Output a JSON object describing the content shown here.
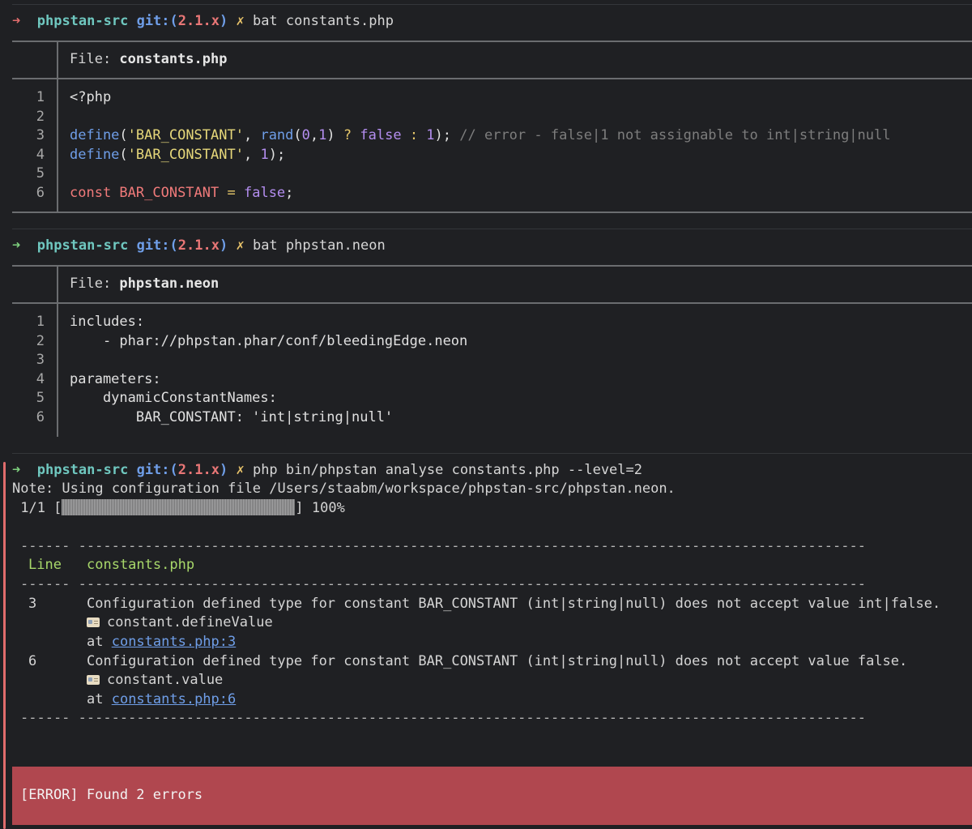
{
  "prompt": {
    "arrow": "➜",
    "dir": "phpstan-src",
    "git_prefix": "git:(",
    "branch": "2.1.x",
    "git_suffix": ")",
    "dirty_mark": "✗"
  },
  "command1": "bat constants.php",
  "file1": {
    "label": "File: ",
    "name": "constants.php",
    "line_numbers": [
      "1",
      "2",
      "3",
      "4",
      "5",
      "6"
    ],
    "lines": {
      "l1": "<?php",
      "l3_define": "define",
      "l3_open": "(",
      "l3_str": "'BAR_CONSTANT'",
      "l3_comma": ", ",
      "l3_rand": "rand",
      "l3_args_open": "(",
      "l3_zero": "0",
      "l3_argcomma": ",",
      "l3_one": "1",
      "l3_args_close": ") ",
      "l3_q": "?",
      "l3_sp": " ",
      "l3_false": "false",
      "l3_colon": " : ",
      "l3_one2": "1",
      "l3_close": ");",
      "l3_comment": " // error - false|1 not assignable to int|string|null",
      "l4_define": "define",
      "l4_open": "(",
      "l4_str": "'BAR_CONSTANT'",
      "l4_comma": ", ",
      "l4_one": "1",
      "l4_close": ");",
      "l6_const": "const",
      "l6_name": " BAR_CONSTANT ",
      "l6_eq": "=",
      "l6_sp": " ",
      "l6_false": "false",
      "l6_semi": ";"
    }
  },
  "command2": "bat phpstan.neon",
  "file2": {
    "label": "File: ",
    "name": "phpstan.neon",
    "line_numbers": [
      "1",
      "2",
      "3",
      "4",
      "5",
      "6"
    ],
    "lines": [
      "includes:",
      "    - phar://phpstan.phar/conf/bleedingEdge.neon",
      "",
      "parameters:",
      "    dynamicConstantNames:",
      "        BAR_CONSTANT: 'int|string|null'"
    ]
  },
  "command3": "php bin/phpstan analyse constants.php --level=2",
  "analysis": {
    "note": "Note: Using configuration file /Users/staabm/workspace/phpstan-src/phpstan.neon.",
    "progress_count": " 1/1 [",
    "progress_end": "] 100%",
    "progress_fraction": 1.0,
    "dash_short": "------",
    "dash_long": "-----------------------------------------------------------------------------------------------",
    "col_line": "Line",
    "col_file": "constants.php",
    "errors": [
      {
        "line": "3",
        "message": "Configuration defined type for constant BAR_CONSTANT (int|string|null) does not accept value int|false.",
        "icon": "id-card-icon",
        "identifier": "constant.defineValue",
        "at": "at ",
        "link": "constants.php:3"
      },
      {
        "line": "6",
        "message": "Configuration defined type for constant BAR_CONSTANT (int|string|null) does not accept value false.",
        "icon": "id-card-icon",
        "identifier": "constant.value",
        "at": "at ",
        "link": "constants.php:6"
      }
    ],
    "error_summary": "[ERROR] Found 2 errors"
  },
  "colors": {
    "background": "#1f2023",
    "error_bar": "#b0474f",
    "prompt_dir": "#6fc7bf",
    "git": "#6f9ee8",
    "branch": "#e87676",
    "link": "#6f9ee8"
  }
}
